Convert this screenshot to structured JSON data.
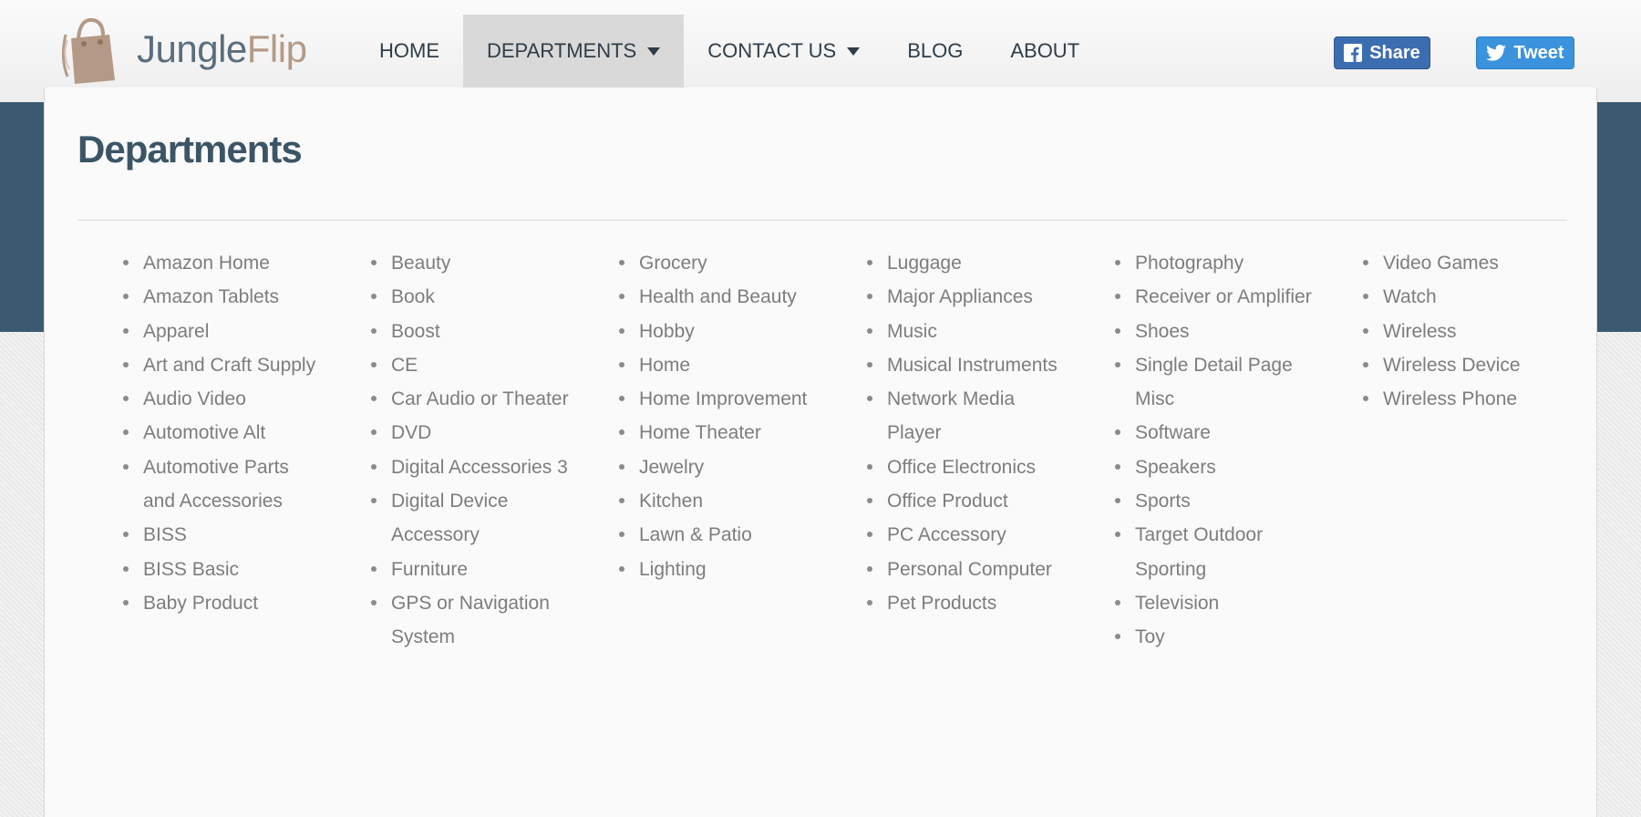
{
  "brand": {
    "name_part1": "Jungle",
    "name_part2": "Flip",
    "colors": {
      "part1": "#5a6e7e",
      "part2": "#b49a86"
    }
  },
  "nav": {
    "items": [
      {
        "label": "HOME",
        "dropdown": false,
        "active": false
      },
      {
        "label": "DEPARTMENTS",
        "dropdown": true,
        "active": true
      },
      {
        "label": "CONTACT US",
        "dropdown": true,
        "active": false
      },
      {
        "label": "BLOG",
        "dropdown": false,
        "active": false
      },
      {
        "label": "ABOUT",
        "dropdown": false,
        "active": false
      }
    ]
  },
  "social": {
    "share_label": "Share",
    "tweet_label": "Tweet",
    "share_icon": "facebook-icon",
    "tweet_icon": "twitter-icon",
    "colors": {
      "share": "#3c6db0",
      "tweet": "#3b93dd"
    }
  },
  "departments": {
    "title": "Departments",
    "columns": [
      [
        "Amazon Home",
        "Amazon Tablets",
        "Apparel",
        "Art and Craft Supply",
        "Audio Video",
        "Automotive Alt",
        "Automotive Parts and Accessories",
        "BISS",
        "BISS Basic",
        "Baby Product"
      ],
      [
        "Beauty",
        "Book",
        "Boost",
        "CE",
        "Car Audio or Theater",
        "DVD",
        "Digital Accessories 3",
        "Digital Device Accessory",
        "Furniture",
        "GPS or Navigation System"
      ],
      [
        "Grocery",
        "Health and Beauty",
        "Hobby",
        "Home",
        "Home Improvement",
        "Home Theater",
        "Jewelry",
        "Kitchen",
        "Lawn & Patio",
        "Lighting"
      ],
      [
        "Luggage",
        "Major Appliances",
        "Music",
        "Musical Instruments",
        "Network Media Player",
        "Office Electronics",
        "Office Product",
        "PC Accessory",
        "Personal Computer",
        "Pet Products"
      ],
      [
        "Photography",
        "Receiver or Amplifier",
        "Shoes",
        "Single Detail Page Misc",
        "Software",
        "Speakers",
        "Sports",
        "Target Outdoor Sporting",
        "Television",
        "Toy"
      ],
      [
        "Video Games",
        "Watch",
        "Wireless",
        "Wireless Device",
        "Wireless Phone"
      ]
    ]
  },
  "theme": {
    "header_band": "#3b5a70",
    "title_color": "#3b5566",
    "link_color": "#7d7d7d"
  }
}
